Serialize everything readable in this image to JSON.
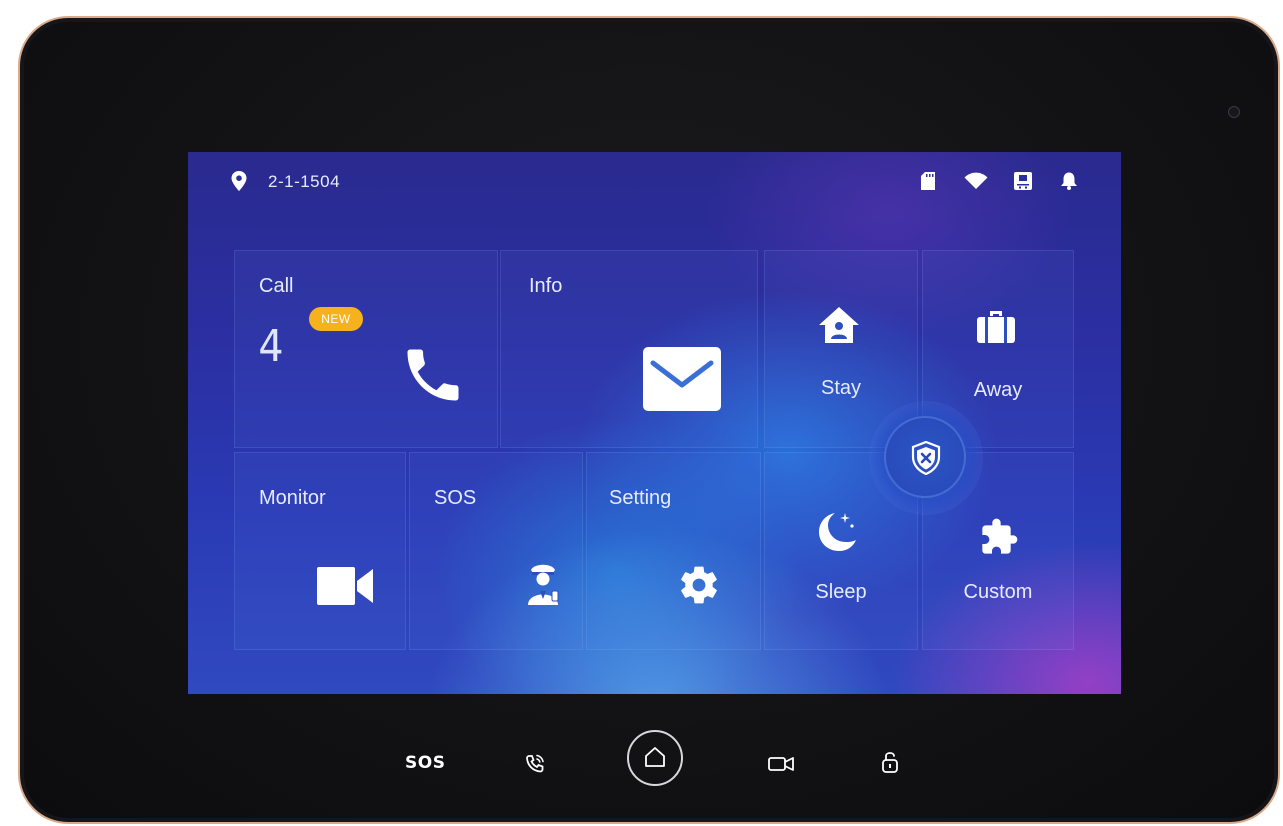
{
  "status_bar": {
    "room_number": "2-1-1504",
    "icons": [
      "location-pin-icon",
      "sd-card-icon",
      "wifi-icon",
      "disarm-indicator-icon",
      "bell-icon"
    ]
  },
  "tiles": {
    "call": {
      "label": "Call",
      "count": "4",
      "badge": "NEW",
      "icon": "phone-icon"
    },
    "info": {
      "label": "Info",
      "icon": "envelope-icon"
    },
    "monitor": {
      "label": "Monitor",
      "icon": "video-camera-icon"
    },
    "sos": {
      "label": "SOS",
      "icon": "security-guard-icon"
    },
    "setting": {
      "label": "Setting",
      "icon": "gear-icon"
    },
    "stay": {
      "label": "Stay",
      "icon": "home-person-icon"
    },
    "away": {
      "label": "Away",
      "icon": "briefcase-icon"
    },
    "sleep": {
      "label": "Sleep",
      "icon": "moon-icon"
    },
    "custom": {
      "label": "Custom",
      "icon": "puzzle-icon"
    },
    "arm_toggle": {
      "icon": "shield-x-icon"
    }
  },
  "hardware_buttons": {
    "sos_label": "SOS",
    "icons": [
      "phone-call-icon",
      "home-icon",
      "camera-icon",
      "unlock-icon"
    ]
  },
  "colors": {
    "badge": "#f5b21c",
    "frame_border": "#d9a98a",
    "screen_base": "#2a2f9f"
  }
}
